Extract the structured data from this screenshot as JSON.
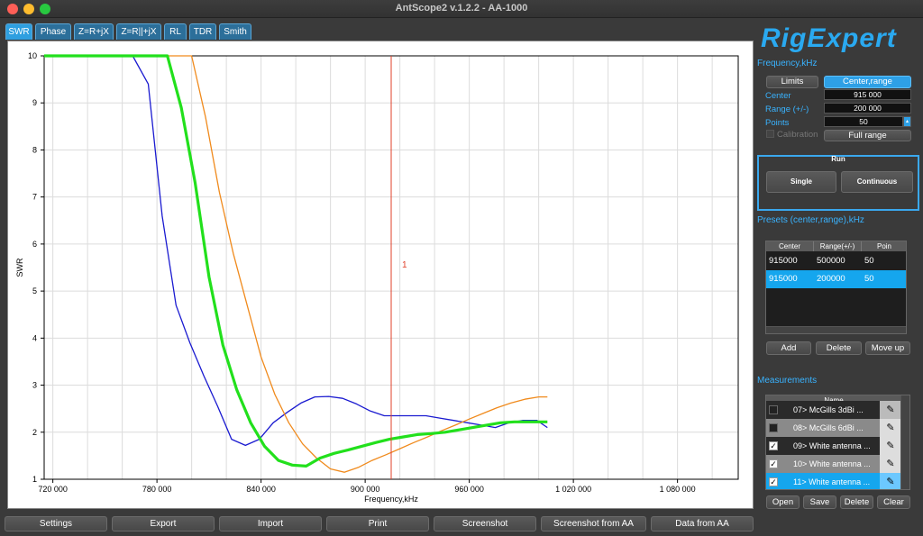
{
  "window": {
    "title": "AntScope2 v.1.2.2 - AA-1000"
  },
  "tabs": [
    "SWR",
    "Phase",
    "Z=R+jX",
    "Z=R||+jX",
    "RL",
    "TDR",
    "Smith"
  ],
  "logo": {
    "text": "RigExpert"
  },
  "frequency": {
    "title": "Frequency,kHz",
    "limits_label": "Limits",
    "center_range_label": "Center,range",
    "center_label": "Center",
    "center_value": "915 000",
    "range_label": "Range (+/-)",
    "range_value": "200 000",
    "points_label": "Points",
    "points_value": "50",
    "calibration_label": "Calibration",
    "full_range_label": "Full range"
  },
  "run": {
    "title": "Run",
    "single_label": "Single",
    "continuous_label": "Continuous"
  },
  "presets": {
    "title": "Presets (center,range),kHz",
    "headers": [
      "Center",
      "Range(+/-)",
      "Poin"
    ],
    "rows": [
      [
        "915000",
        "500000",
        "50"
      ],
      [
        "915000",
        "200000",
        "50"
      ]
    ],
    "add_label": "Add",
    "delete_label": "Delete",
    "moveup_label": "Move up"
  },
  "measurements": {
    "title": "Measurements",
    "header": "Name",
    "items": [
      {
        "name": "07> McGills 3dBi ...",
        "checked": false
      },
      {
        "name": "08> McGills 6dBi ...",
        "checked": false
      },
      {
        "name": "09> White antenna ...",
        "checked": true
      },
      {
        "name": "10> White antenna ...",
        "checked": true
      },
      {
        "name": "11> White antenna ...",
        "checked": true
      }
    ],
    "open_label": "Open",
    "save_label": "Save",
    "delete_label": "Delete",
    "clear_label": "Clear"
  },
  "bottom_buttons": [
    "Settings",
    "Export",
    "Import",
    "Print",
    "Screenshot",
    "Screenshot from AA",
    "Data from AA"
  ],
  "colors": {
    "accent": "#2ea0e6",
    "marker": "#e0402a",
    "series_blue": "#1a1ad0",
    "series_orange": "#f08a1c",
    "series_green": "#22e01c"
  },
  "chart_data": {
    "type": "line",
    "xlabel": "Frequency,kHz",
    "ylabel": "SWR",
    "xlim": [
      715000,
      1115000
    ],
    "ylim": [
      1,
      10
    ],
    "xticks": [
      720000,
      780000,
      840000,
      900000,
      960000,
      1020000,
      1080000
    ],
    "xtick_labels": [
      "720 000",
      "780 000",
      "840 000",
      "900 000",
      "960 000",
      "1 020 000",
      "1 080 000"
    ],
    "yticks": [
      1,
      2,
      3,
      4,
      5,
      6,
      7,
      8,
      9,
      10
    ],
    "grid": true,
    "marker": {
      "x": 915000,
      "label": "1"
    },
    "series": [
      {
        "color": "#1a1ad0",
        "width": 1.3,
        "x": [
          715000,
          766000,
          775000,
          783000,
          791000,
          799000,
          807000,
          815000,
          823000,
          831000,
          839000,
          847000,
          855000,
          863000,
          871000,
          879000,
          887000,
          895000,
          903000,
          911000,
          919000,
          927000,
          935000,
          943000,
          951000,
          959000,
          967000,
          975000,
          983000,
          991000,
          999000,
          1005000
        ],
        "y": [
          10,
          10,
          9.4,
          6.6,
          4.7,
          3.9,
          3.2,
          2.55,
          1.85,
          1.72,
          1.85,
          2.2,
          2.42,
          2.62,
          2.75,
          2.76,
          2.72,
          2.6,
          2.45,
          2.35,
          2.35,
          2.35,
          2.35,
          2.3,
          2.25,
          2.2,
          2.15,
          2.1,
          2.2,
          2.25,
          2.25,
          2.1
        ]
      },
      {
        "color": "#f08a1c",
        "width": 1.3,
        "x": [
          715000,
          794000,
          800000,
          808000,
          816000,
          824000,
          832000,
          840000,
          848000,
          856000,
          864000,
          872000,
          880000,
          888000,
          896000,
          904000,
          912000,
          920000,
          928000,
          936000,
          944000,
          952000,
          960000,
          968000,
          976000,
          984000,
          992000,
          1000000,
          1005000
        ],
        "y": [
          10,
          10,
          10,
          8.7,
          7.1,
          5.8,
          4.7,
          3.6,
          2.8,
          2.2,
          1.75,
          1.45,
          1.22,
          1.15,
          1.25,
          1.4,
          1.52,
          1.65,
          1.78,
          1.9,
          2.03,
          2.15,
          2.28,
          2.4,
          2.52,
          2.62,
          2.7,
          2.75,
          2.75
        ]
      },
      {
        "color": "#22e01c",
        "width": 3.2,
        "x": [
          715000,
          786000,
          794000,
          802000,
          810000,
          818000,
          826000,
          834000,
          842000,
          850000,
          858000,
          866000,
          874000,
          882000,
          890000,
          898000,
          906000,
          914000,
          922000,
          930000,
          938000,
          946000,
          954000,
          962000,
          970000,
          978000,
          986000,
          994000,
          1005000
        ],
        "y": [
          10,
          10,
          8.9,
          7.3,
          5.3,
          3.85,
          2.9,
          2.2,
          1.7,
          1.4,
          1.3,
          1.28,
          1.45,
          1.55,
          1.62,
          1.7,
          1.78,
          1.85,
          1.9,
          1.95,
          1.97,
          2.0,
          2.05,
          2.1,
          2.15,
          2.2,
          2.22,
          2.22,
          2.22
        ]
      }
    ]
  }
}
